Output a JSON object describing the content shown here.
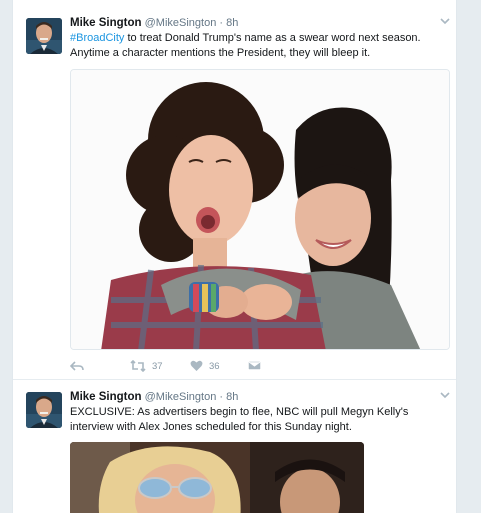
{
  "tweets": [
    {
      "author_name": "Mike Sington",
      "author_handle": "@MikeSington",
      "separator": "·",
      "time": "8h",
      "hashtag": "#BroadCity",
      "text": " to treat Donald Trump's name as a swear word next season. Anytime a character mentions the President, they will bleep it.",
      "actions": {
        "retweets": "37",
        "likes": "36"
      }
    },
    {
      "author_name": "Mike Sington",
      "author_handle": "@MikeSington",
      "separator": "·",
      "time": "8h",
      "text": "EXCLUSIVE: As advertisers begin to flee, NBC will pull Megyn Kelly's interview with Alex Jones scheduled for this Sunday night."
    }
  ],
  "colors": {
    "link": "#1b95e0",
    "muted": "#657786",
    "action_icon": "#aab8c2",
    "page_bg": "#e6ecf0"
  },
  "icons": [
    "caret-down-icon",
    "reply-icon",
    "retweet-icon",
    "heart-icon",
    "direct-message-icon"
  ]
}
